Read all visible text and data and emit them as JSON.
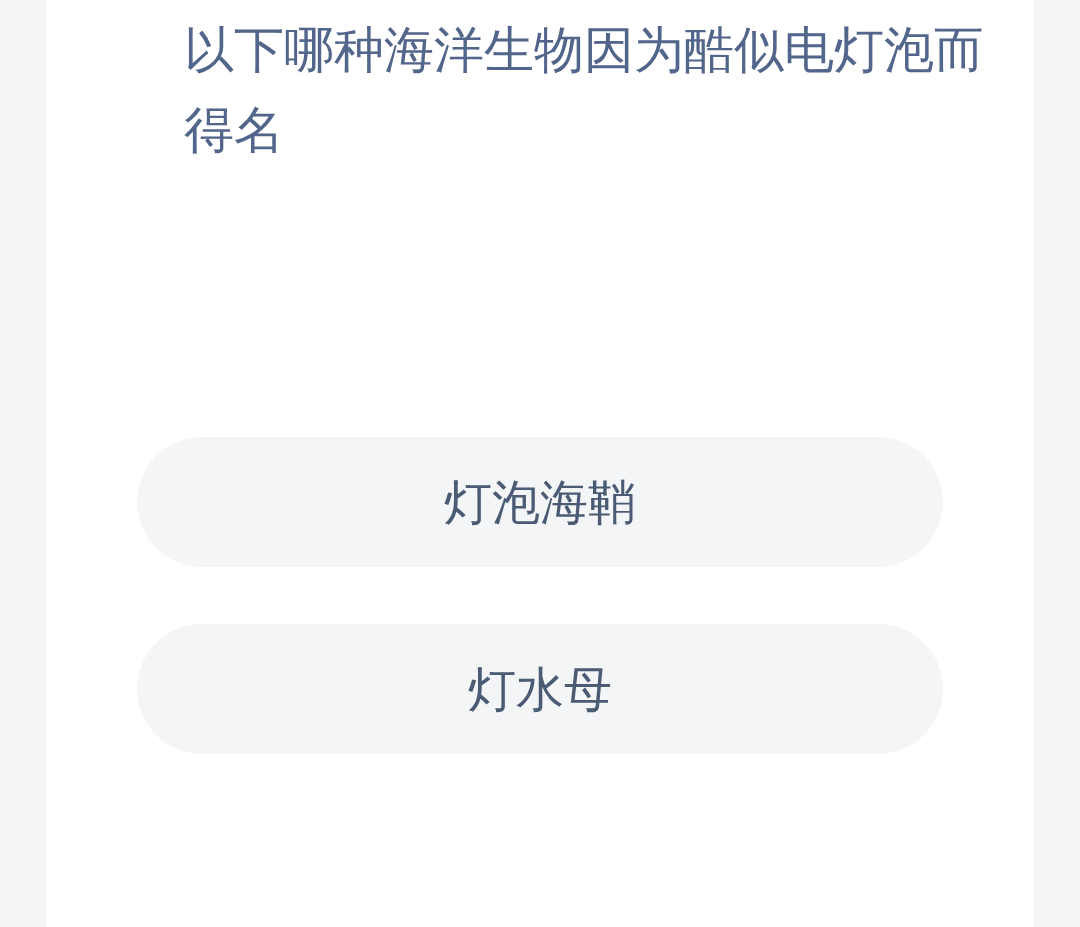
{
  "question": "以下哪种海洋生物因为酷似电灯泡而得名",
  "options": [
    {
      "label": "灯泡海鞘"
    },
    {
      "label": "灯水母"
    }
  ]
}
